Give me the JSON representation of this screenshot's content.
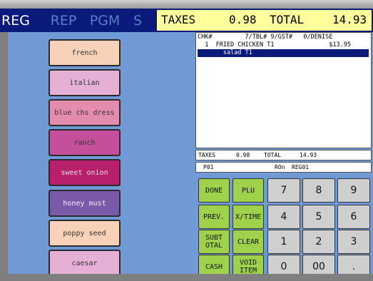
{
  "tabs": [
    {
      "label": "REG",
      "active": true
    },
    {
      "label": "REP",
      "active": false
    },
    {
      "label": "PGM",
      "active": false
    },
    {
      "label": "S",
      "active": false
    }
  ],
  "header": {
    "taxes_label": "TAXES",
    "taxes_value": "0.98",
    "total_label": "TOTAL",
    "total_value": "14.93"
  },
  "options": [
    "french",
    "italian",
    "blue chs dress",
    "ranch",
    "sweet onion",
    "honey must",
    "poppy seed",
    "caesar"
  ],
  "receipt": {
    "line1": "CHK#         7/TBL# 9/GST#   0/DENISE",
    "line2": "  1  FRIED CHICKEN T1               $13.95",
    "line3": "       salad T1"
  },
  "summary": {
    "taxes_label": "TAXES",
    "taxes_value": "0.98",
    "total_label": "TOTAL",
    "total_value": "14.93"
  },
  "status": {
    "p": "P01",
    "r": "ROn",
    "reg": "REG01"
  },
  "keys": {
    "done": "DONE",
    "plu": "PLU",
    "prev": "PREV.",
    "xtime": "X/TIME",
    "subtotal": "SUBT\nOTAL",
    "clear": "CLEAR",
    "cash": "CASH",
    "void": "VOID\nITEM",
    "n7": "7",
    "n8": "8",
    "n9": "9",
    "n4": "4",
    "n5": "5",
    "n6": "6",
    "n1": "1",
    "n2": "2",
    "n3": "3",
    "n0": "0",
    "n00": "00",
    "dot": "."
  },
  "colors": {
    "navy": "#0a1a7a",
    "panel": "#6f9ad6",
    "taxbar": "#ffff9c",
    "green": "#9fd24a",
    "gray": "#cfcfcf"
  }
}
